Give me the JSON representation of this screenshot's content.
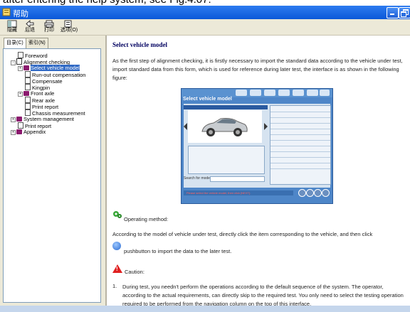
{
  "caption": "after entering the help system, see Fig.4.07:",
  "window": {
    "title": "帮助"
  },
  "toolbar": {
    "items": [
      {
        "label": "隐藏"
      },
      {
        "label": "后退"
      },
      {
        "label": "打印"
      },
      {
        "label": "选项(O)"
      }
    ]
  },
  "nav_tabs": [
    {
      "label": "目录(C)"
    },
    {
      "label": "索引(N)"
    }
  ],
  "tree": {
    "foreword": "Foreword",
    "alignment_checking": "Alignment checking",
    "select_vehicle_model": "Select vehicle model",
    "runout_compensation": "Run-out compensation",
    "compensate": "Compensate",
    "kingpin": "Kingpin",
    "front_axle": "Front axle",
    "rear_axle": "Rear axle",
    "print_report_1": "Print report",
    "chassis_measurement": "Chassis measurement",
    "system_management": "System management",
    "print_report_2": "Print report",
    "appendix": "Appendix"
  },
  "content": {
    "heading": "Select vehicle model",
    "para1": "As the first step of alignment checking, it is firstly necessary to import the standard data according to the vehicle under test, import standard data from this form, which is used for reference during later test, the interface is as shown in the following figure:",
    "figure": {
      "title": "Select vehicle model",
      "search_label": "Search for model",
      "status_text": "Please select the vehicle model, then click [NEXT]."
    },
    "operating_method": "Operating method:",
    "para2": "According to the model of vehicle under test, directly click the item corresponding to the vehicle, and then click",
    "para3": "pushbutton to import the data to the later test.",
    "caution": "Caution:",
    "list_num": "1.",
    "para4": "During test, you needn't perform the operations according to the default sequence of the system. The operator, according to the actual requirements, can directly skip to the required test. You only need to select the testing operation required to be performed from the navigation column on the top of this interface."
  },
  "icons": {
    "app": "help-app-icon",
    "hide": "hide-icon",
    "back": "back-icon",
    "print": "print-icon",
    "options": "options-icon"
  },
  "colors": {
    "titlebar": "#0a58d8",
    "selection": "#316ac5",
    "heading": "#000060"
  }
}
